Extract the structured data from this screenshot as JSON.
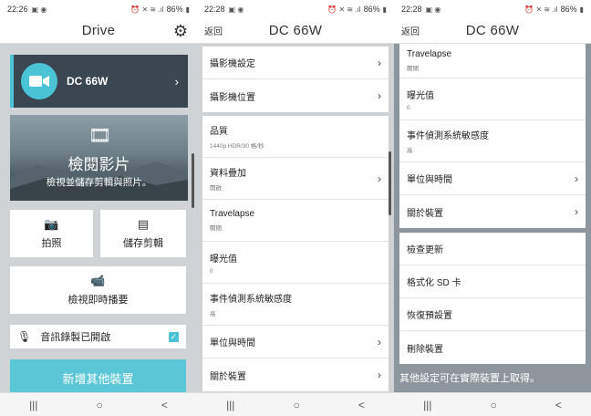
{
  "panel1": {
    "status": {
      "time": "22:26",
      "battery": "86%"
    },
    "title": "Drive",
    "device_name": "DC 66W",
    "hero_title": "檢閱影片",
    "hero_subtitle": "檢視並儲存剪輯與照片。",
    "photo_label": "拍照",
    "save_clip_label": "儲存剪輯",
    "live_view_label": "檢視即時播要",
    "audio_label": "音訊錄製已開啟",
    "add_device_label": "新增其他裝置"
  },
  "panel2": {
    "status": {
      "time": "22:28",
      "battery": "86%"
    },
    "back": "返回",
    "title": "DC 66W",
    "group1": [
      {
        "label": "攝影機設定"
      },
      {
        "label": "攝影機位置"
      }
    ],
    "group2": [
      {
        "label": "品質",
        "sub": "1440p HDR/30 格/秒"
      },
      {
        "label": "資料疊加",
        "sub": "開啟"
      },
      {
        "label": "Travelapse",
        "sub": "關閉"
      },
      {
        "label": "曝光值",
        "sub": "0"
      },
      {
        "label": "事件偵測系統敏感度",
        "sub": "高"
      },
      {
        "label": "單位與時間"
      },
      {
        "label": "關於裝置"
      }
    ]
  },
  "panel3": {
    "status": {
      "time": "22:28",
      "battery": "86%"
    },
    "back": "返回",
    "title": "DC 66W",
    "group1": [
      {
        "label": "Travelapse",
        "sub": "關閉"
      },
      {
        "label": "曝光值",
        "sub": "0"
      },
      {
        "label": "事件偵測系統敏感度",
        "sub": "高"
      },
      {
        "label": "單位與時間"
      },
      {
        "label": "關於裝置"
      }
    ],
    "group2": [
      {
        "label": "檢查更新"
      },
      {
        "label": "格式化 SD 卡"
      },
      {
        "label": "恢復預設置"
      },
      {
        "label": "刪除裝置"
      }
    ],
    "footnote": "其他設定可在實際裝置上取得。"
  },
  "icons": {
    "accent": "#4bc3d6",
    "nav_recent": "|||",
    "nav_home": "○",
    "nav_back": "<"
  }
}
